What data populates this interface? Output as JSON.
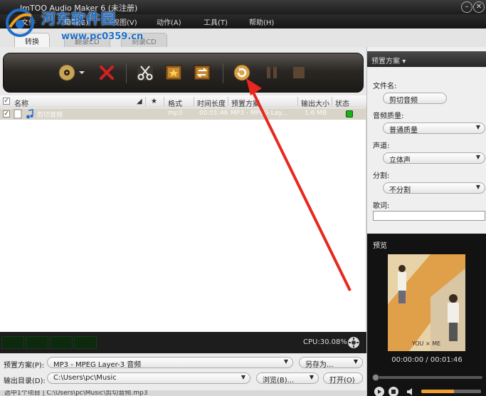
{
  "window": {
    "title": "ImTOO Audio Maker 6 (未注册)",
    "watermark_cn": "河东软件园",
    "watermark_url": "www.pc0359.cn"
  },
  "menu": {
    "items": [
      "文件",
      "编辑(E)",
      "视图(V)",
      "动作(A)",
      "工具(T)",
      "帮助(H)"
    ]
  },
  "tabs": [
    "转换",
    "翻录CD",
    "刻录CD"
  ],
  "toolbar": {
    "buttons": [
      "add-file",
      "dropdown",
      "remove",
      "cut",
      "effects",
      "merge",
      "convert",
      "pause",
      "stop"
    ]
  },
  "list": {
    "headers": [
      "名称",
      "★",
      "格式",
      "时间长度",
      "预置方案",
      "输出大小",
      "状态"
    ],
    "rows": [
      {
        "name": "剪切音频",
        "format": "mp3",
        "duration": "00:01:46",
        "profile": "MP3 - MPEG Lay...",
        "size": "1.6 MB",
        "status_color": "#19b219"
      }
    ]
  },
  "status": {
    "cpu": "CPU:30.08%",
    "meter_levels": [
      1.0,
      0.8,
      0.7,
      0.5
    ]
  },
  "bottom": {
    "profile_label": "预置方案(P):",
    "profile_value": "MP3 - MPEG Layer-3 音频",
    "save_as": "另存为...",
    "output_label": "输出目录(D):",
    "output_value": "C:\\Users\\pc\\Music",
    "browse": "浏览(B)...",
    "open": "打开(O)",
    "statusline": "选中1个项目 | C:\\Users\\pc\\Music\\剪切音频.mp3"
  },
  "right_panel": {
    "header": "预置方案",
    "filename_label": "文件名:",
    "filename_value": "剪切音频",
    "quality_label": "音频质量:",
    "quality_value": "普通质量",
    "channel_label": "声道:",
    "channel_value": "立体声",
    "split_label": "分割:",
    "split_value": "不分割",
    "lyrics_label": "歌词:",
    "preview_title": "预览",
    "cover_text": "YOU × ME",
    "time_display": "00:00:00 / 00:01:46",
    "volume_level": 0.55
  },
  "colors": {
    "accent_status": "#19b219",
    "arrow": "#e8281e"
  }
}
